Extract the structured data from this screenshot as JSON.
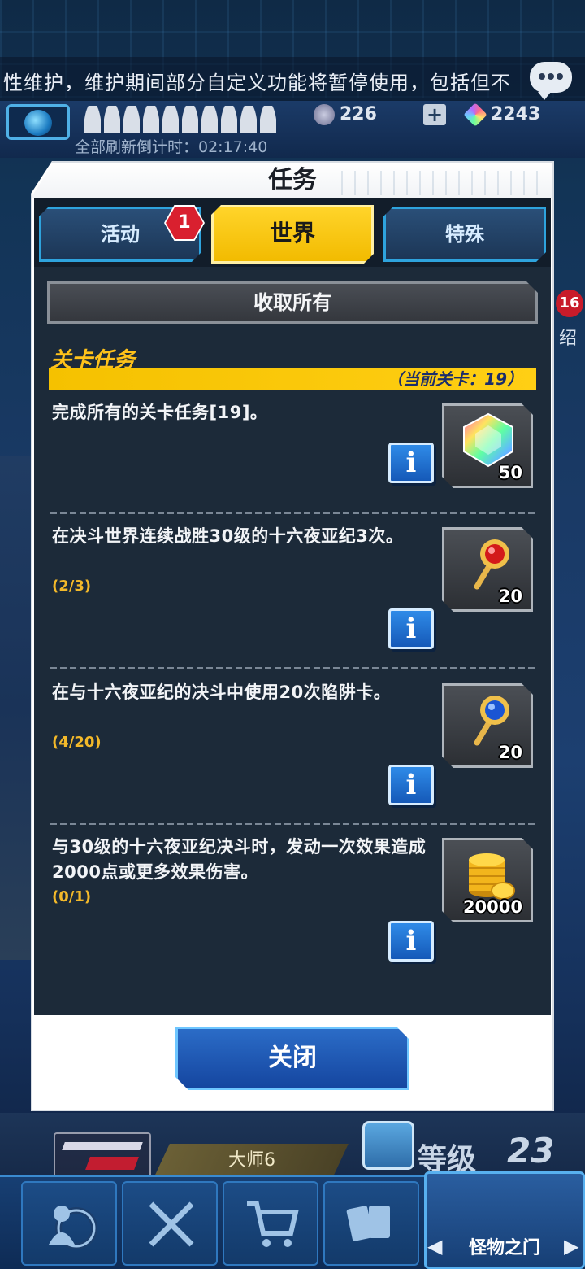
{
  "ticker": {
    "text": "性维护，维护期间部分自定义功能将暂停使用，包括但不"
  },
  "status": {
    "refresh_countdown": "全部刷新倒计时：02:17:40",
    "currency_a": "226",
    "currency_plus": "+",
    "currency_b": "2243"
  },
  "side": {
    "badge": "16",
    "char": "绍"
  },
  "modal": {
    "title": "任务",
    "tabs": [
      {
        "label": "活动",
        "badge": "1"
      },
      {
        "label": "世界"
      },
      {
        "label": "特殊"
      }
    ],
    "collect_all": "收取所有",
    "section_title": "关卡任务",
    "section_level": "（当前关卡：19）",
    "missions": [
      {
        "text": "完成所有的关卡任务[19]。",
        "progress": "",
        "reward_qty": "50",
        "reward_icon": "gem-icon"
      },
      {
        "text": "在决斗世界连续战胜30级的十六夜亚纪3次。",
        "progress": "(2/3)",
        "reward_qty": "20",
        "reward_icon": "red-key-icon"
      },
      {
        "text": "在与十六夜亚纪的决斗中使用20次陷阱卡。",
        "progress": "(4/20)",
        "reward_qty": "20",
        "reward_icon": "blue-key-icon"
      },
      {
        "text": "与30级的十六夜亚纪决斗时，发动一次效果造成2000点或更多效果伤害。",
        "progress": "(0/1)",
        "reward_qty": "20000",
        "reward_icon": "gold-coins-icon"
      }
    ],
    "info_label": "i",
    "close": "关闭"
  },
  "bottom": {
    "rank": "大师6",
    "level_label": "等级",
    "level_value": "23",
    "nav_active": "怪物之门",
    "nav_left": "◀",
    "nav_right": "▶"
  },
  "colors": {
    "accent_yellow": "#ffc21a",
    "panel_bg": "#1c2a39",
    "progress_color": "#f3b92a",
    "info_blue": "#2f8be8"
  }
}
